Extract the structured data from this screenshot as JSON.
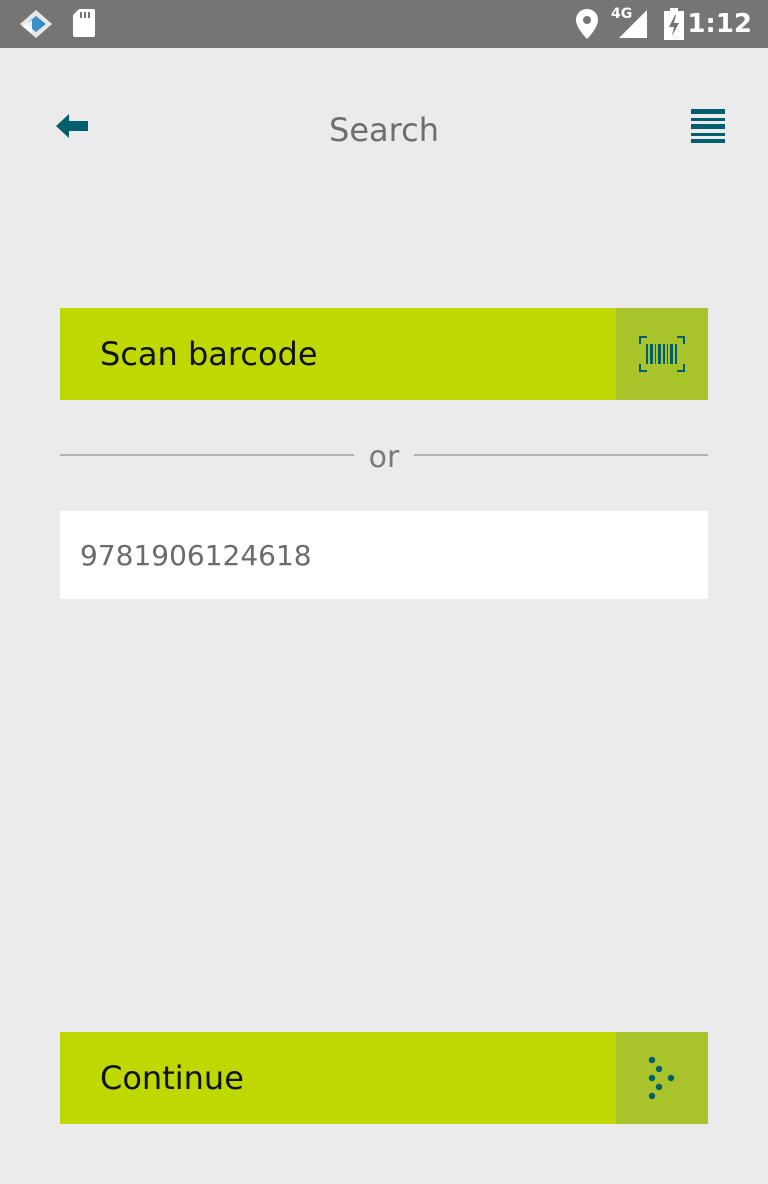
{
  "status_bar": {
    "time": "1:12",
    "network_label": "4G",
    "icons": [
      "app-notification-icon",
      "sd-card-icon",
      "location-icon",
      "signal-icon",
      "battery-charging-icon"
    ]
  },
  "header": {
    "title": "Search",
    "back_icon": "back-arrow-icon",
    "menu_icon": "hamburger-menu-icon"
  },
  "scan": {
    "label": "Scan barcode",
    "icon": "barcode-scan-icon"
  },
  "divider": {
    "text": "or"
  },
  "isbn_field": {
    "value": "9781906124618"
  },
  "continue": {
    "label": "Continue",
    "icon": "arrow-dots-icon"
  },
  "colors": {
    "accent_green": "#bed800",
    "icon_box_green": "#a9c42b",
    "teal": "#005f6e",
    "background": "#ebebeb",
    "status_bar": "#757575"
  }
}
